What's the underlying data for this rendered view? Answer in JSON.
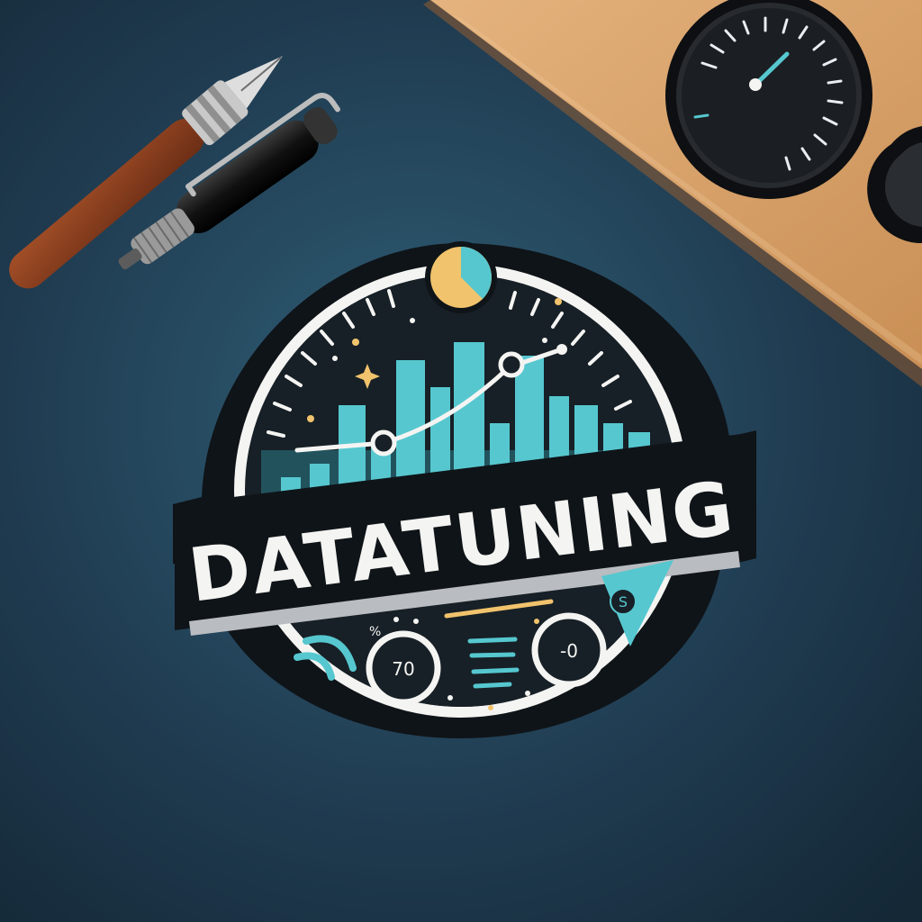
{
  "logo": {
    "wordmark": "DATATUNING",
    "left_dial_label": "70",
    "right_dial_label": "-0",
    "percent_mark": "%",
    "small_glyph": "S"
  },
  "colors": {
    "desk": "#1f3a4f",
    "sticker_white": "#f4f4f2",
    "badge_dark": "#172026",
    "teal": "#56c7cf",
    "amber": "#f1c36c",
    "wood": "#d9a56c",
    "pen_wood": "#8a3f1f"
  },
  "props": {
    "left_items": [
      "fountain-pen",
      "black-pen"
    ],
    "right_items": [
      "wood-panel",
      "gauge-dial"
    ]
  }
}
